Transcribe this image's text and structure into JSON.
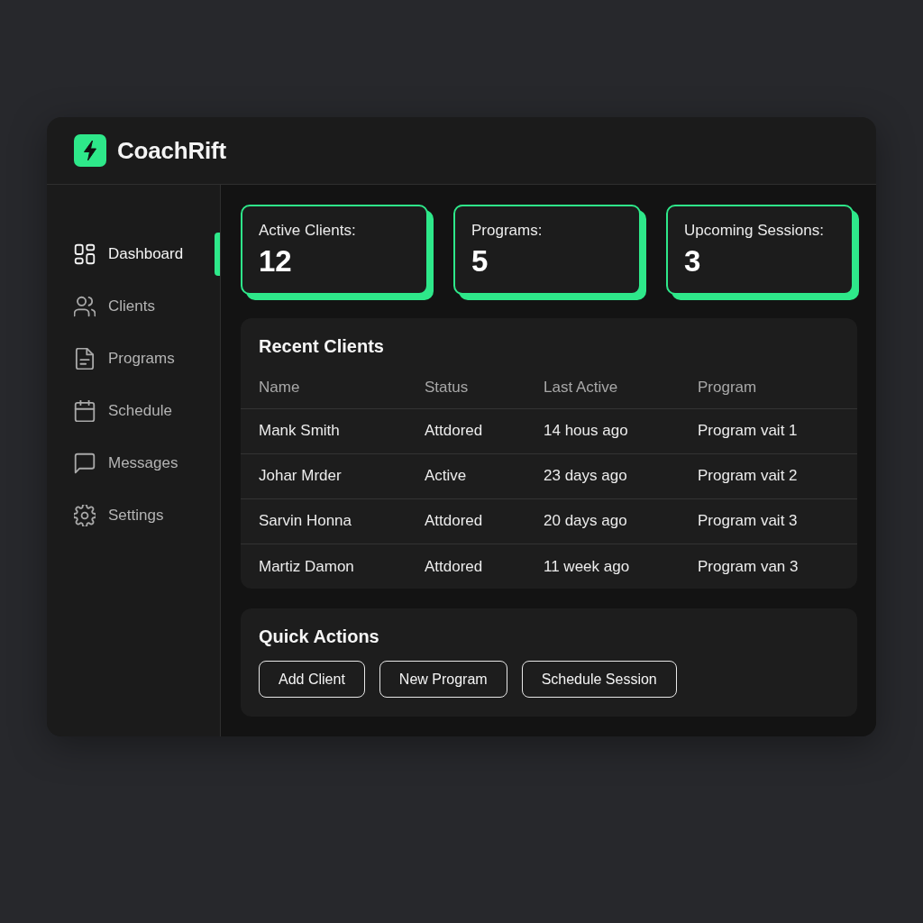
{
  "app": {
    "name": "CoachRift"
  },
  "sidebar": {
    "items": [
      {
        "label": "Dashboard",
        "selected": true
      },
      {
        "label": "Clients",
        "selected": false
      },
      {
        "label": "Programs",
        "selected": false
      },
      {
        "label": "Schedule",
        "selected": false
      },
      {
        "label": "Messages",
        "selected": false
      },
      {
        "label": "Settings",
        "selected": false
      }
    ]
  },
  "stats": [
    {
      "label": "Active Clients:",
      "value": "12"
    },
    {
      "label": "Programs:",
      "value": "5"
    },
    {
      "label": "Upcoming Sessions:",
      "value": "3"
    }
  ],
  "recent_clients": {
    "title": "Recent Clients",
    "columns": [
      "Name",
      "Status",
      "Last Active",
      "Program"
    ],
    "rows": [
      [
        "Mank Smith",
        "Attdored",
        "14 hous ago",
        "Program vait 1"
      ],
      [
        "Johar Mrder",
        "Active",
        "23 days ago",
        "Program vait 2"
      ],
      [
        "Sarvin Honna",
        "Attdored",
        "20 days ago",
        "Program vait 3"
      ],
      [
        "Martiz Damon",
        "Attdored",
        "11 week ago",
        "Program van 3"
      ]
    ]
  },
  "quick_actions": {
    "title": "Quick Actions",
    "buttons": [
      "Add Client",
      "New Program",
      "Schedule Session"
    ]
  }
}
